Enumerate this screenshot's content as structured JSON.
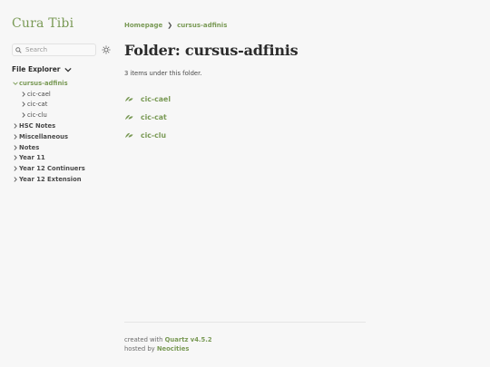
{
  "site": {
    "title": "Cura Tibi"
  },
  "search": {
    "placeholder": "Search"
  },
  "explorer": {
    "title": "File Explorer",
    "items": [
      {
        "label": "cursus-adfinis",
        "level": 0,
        "expanded": true,
        "active": true
      },
      {
        "label": "cic-cael",
        "level": 1
      },
      {
        "label": "cic-cat",
        "level": 1
      },
      {
        "label": "cic-clu",
        "level": 1
      },
      {
        "label": "HSC Notes",
        "level": 0
      },
      {
        "label": "Miscellaneous",
        "level": 0
      },
      {
        "label": "Notes",
        "level": 0
      },
      {
        "label": "Year 11",
        "level": 0
      },
      {
        "label": "Year 12 Continuers",
        "level": 0
      },
      {
        "label": "Year 12 Extension",
        "level": 0
      }
    ]
  },
  "breadcrumb": {
    "home": "Homepage",
    "separator": "❯",
    "current": "cursus-adfinis"
  },
  "main": {
    "title": "Folder: cursus-adfinis",
    "count_text": "3 items under this folder.",
    "folders": [
      {
        "label": "cic-cael"
      },
      {
        "label": "cic-cat"
      },
      {
        "label": "cic-clu"
      }
    ]
  },
  "footer": {
    "created_prefix": "created with ",
    "quartz_link": "Quartz v4.5.2",
    "hosted_prefix": "hosted by ",
    "host_link": "Neocities"
  },
  "colors": {
    "accent": "#7a9a56",
    "background": "#f7f7f7",
    "text": "#3a3a3a"
  }
}
